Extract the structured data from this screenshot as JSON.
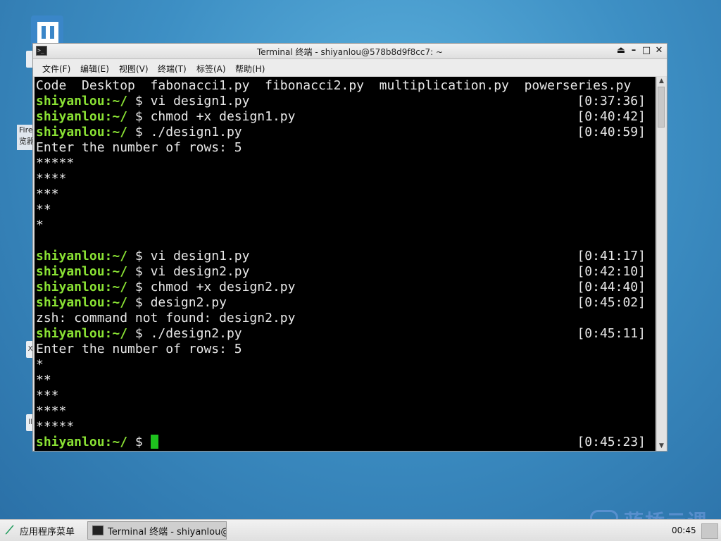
{
  "desktop": {
    "firefox_label": "Fire 览器",
    "stub_x": "X",
    "stub_2": "ll"
  },
  "window": {
    "title": "Terminal 终端 - shiyanlou@578b8d9f8cc7: ~",
    "controls": [
      "⏏",
      "–",
      "□",
      "✕"
    ]
  },
  "menu": [
    "文件(F)",
    "编辑(E)",
    "视图(V)",
    "终端(T)",
    "标签(A)",
    "帮助(H)"
  ],
  "terminal": {
    "user": "shiyanlou",
    "path": ":~/",
    "lines": [
      {
        "type": "out",
        "text": "Code  Desktop  fabonacci1.py  fibonacci2.py  multiplication.py  powerseries.py"
      },
      {
        "type": "prompt",
        "cmd": " $ vi design1.py",
        "ts": "[0:37:36]"
      },
      {
        "type": "prompt",
        "cmd": " $ chmod +x design1.py",
        "ts": "[0:40:42]"
      },
      {
        "type": "prompt",
        "cmd": " $ ./design1.py",
        "ts": "[0:40:59]"
      },
      {
        "type": "out",
        "text": "Enter the number of rows: 5"
      },
      {
        "type": "out",
        "text": "*****"
      },
      {
        "type": "out",
        "text": "****"
      },
      {
        "type": "out",
        "text": "***"
      },
      {
        "type": "out",
        "text": "**"
      },
      {
        "type": "out",
        "text": "*"
      },
      {
        "type": "out",
        "text": ""
      },
      {
        "type": "prompt",
        "cmd": " $ vi design1.py",
        "ts": "[0:41:17]"
      },
      {
        "type": "prompt",
        "cmd": " $ vi design2.py",
        "ts": "[0:42:10]"
      },
      {
        "type": "prompt",
        "cmd": " $ chmod +x design2.py",
        "ts": "[0:44:40]"
      },
      {
        "type": "prompt",
        "cmd": " $ design2.py",
        "ts": "[0:45:02]"
      },
      {
        "type": "out",
        "text": "zsh: command not found: design2.py"
      },
      {
        "type": "prompt",
        "cmd": " $ ./design2.py",
        "ts": "[0:45:11]"
      },
      {
        "type": "out",
        "text": "Enter the number of rows: 5"
      },
      {
        "type": "out",
        "text": "*"
      },
      {
        "type": "out",
        "text": "**"
      },
      {
        "type": "out",
        "text": "***"
      },
      {
        "type": "out",
        "text": "****"
      },
      {
        "type": "out",
        "text": "*****"
      },
      {
        "type": "active",
        "cmd": " $ ",
        "ts": "[0:45:23]"
      }
    ]
  },
  "taskbar": {
    "start_label": "应用程序菜单",
    "task_label": "Terminal 终端 - shiyanlou@…",
    "clock": "00:45",
    "watermark": "蓝桥云课"
  },
  "colors": {
    "prompt": "#8ae234",
    "cursor": "#1ec21e",
    "terminal_bg": "#000000"
  },
  "icons": {
    "app": "app-logo-icon",
    "terminal": "terminal-icon",
    "start": "leaf-icon"
  }
}
